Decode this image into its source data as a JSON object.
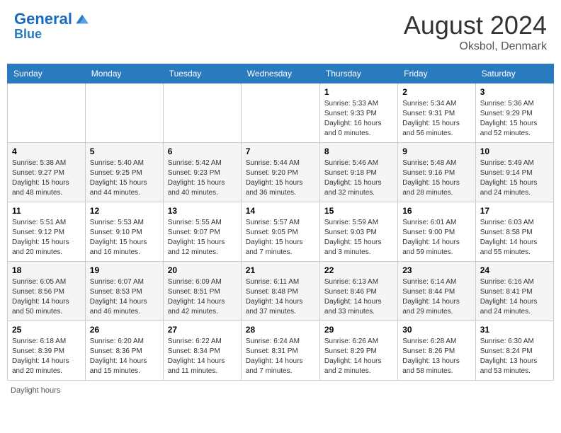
{
  "header": {
    "logo_line1": "General",
    "logo_line2": "Blue",
    "month_year": "August 2024",
    "location": "Oksbol, Denmark"
  },
  "days_of_week": [
    "Sunday",
    "Monday",
    "Tuesday",
    "Wednesday",
    "Thursday",
    "Friday",
    "Saturday"
  ],
  "footer": {
    "daylight_label": "Daylight hours"
  },
  "weeks": [
    {
      "days": [
        {
          "num": "",
          "info": ""
        },
        {
          "num": "",
          "info": ""
        },
        {
          "num": "",
          "info": ""
        },
        {
          "num": "",
          "info": ""
        },
        {
          "num": "1",
          "info": "Sunrise: 5:33 AM\nSunset: 9:33 PM\nDaylight: 16 hours\nand 0 minutes."
        },
        {
          "num": "2",
          "info": "Sunrise: 5:34 AM\nSunset: 9:31 PM\nDaylight: 15 hours\nand 56 minutes."
        },
        {
          "num": "3",
          "info": "Sunrise: 5:36 AM\nSunset: 9:29 PM\nDaylight: 15 hours\nand 52 minutes."
        }
      ]
    },
    {
      "days": [
        {
          "num": "4",
          "info": "Sunrise: 5:38 AM\nSunset: 9:27 PM\nDaylight: 15 hours\nand 48 minutes."
        },
        {
          "num": "5",
          "info": "Sunrise: 5:40 AM\nSunset: 9:25 PM\nDaylight: 15 hours\nand 44 minutes."
        },
        {
          "num": "6",
          "info": "Sunrise: 5:42 AM\nSunset: 9:23 PM\nDaylight: 15 hours\nand 40 minutes."
        },
        {
          "num": "7",
          "info": "Sunrise: 5:44 AM\nSunset: 9:20 PM\nDaylight: 15 hours\nand 36 minutes."
        },
        {
          "num": "8",
          "info": "Sunrise: 5:46 AM\nSunset: 9:18 PM\nDaylight: 15 hours\nand 32 minutes."
        },
        {
          "num": "9",
          "info": "Sunrise: 5:48 AM\nSunset: 9:16 PM\nDaylight: 15 hours\nand 28 minutes."
        },
        {
          "num": "10",
          "info": "Sunrise: 5:49 AM\nSunset: 9:14 PM\nDaylight: 15 hours\nand 24 minutes."
        }
      ]
    },
    {
      "days": [
        {
          "num": "11",
          "info": "Sunrise: 5:51 AM\nSunset: 9:12 PM\nDaylight: 15 hours\nand 20 minutes."
        },
        {
          "num": "12",
          "info": "Sunrise: 5:53 AM\nSunset: 9:10 PM\nDaylight: 15 hours\nand 16 minutes."
        },
        {
          "num": "13",
          "info": "Sunrise: 5:55 AM\nSunset: 9:07 PM\nDaylight: 15 hours\nand 12 minutes."
        },
        {
          "num": "14",
          "info": "Sunrise: 5:57 AM\nSunset: 9:05 PM\nDaylight: 15 hours\nand 7 minutes."
        },
        {
          "num": "15",
          "info": "Sunrise: 5:59 AM\nSunset: 9:03 PM\nDaylight: 15 hours\nand 3 minutes."
        },
        {
          "num": "16",
          "info": "Sunrise: 6:01 AM\nSunset: 9:00 PM\nDaylight: 14 hours\nand 59 minutes."
        },
        {
          "num": "17",
          "info": "Sunrise: 6:03 AM\nSunset: 8:58 PM\nDaylight: 14 hours\nand 55 minutes."
        }
      ]
    },
    {
      "days": [
        {
          "num": "18",
          "info": "Sunrise: 6:05 AM\nSunset: 8:56 PM\nDaylight: 14 hours\nand 50 minutes."
        },
        {
          "num": "19",
          "info": "Sunrise: 6:07 AM\nSunset: 8:53 PM\nDaylight: 14 hours\nand 46 minutes."
        },
        {
          "num": "20",
          "info": "Sunrise: 6:09 AM\nSunset: 8:51 PM\nDaylight: 14 hours\nand 42 minutes."
        },
        {
          "num": "21",
          "info": "Sunrise: 6:11 AM\nSunset: 8:48 PM\nDaylight: 14 hours\nand 37 minutes."
        },
        {
          "num": "22",
          "info": "Sunrise: 6:13 AM\nSunset: 8:46 PM\nDaylight: 14 hours\nand 33 minutes."
        },
        {
          "num": "23",
          "info": "Sunrise: 6:14 AM\nSunset: 8:44 PM\nDaylight: 14 hours\nand 29 minutes."
        },
        {
          "num": "24",
          "info": "Sunrise: 6:16 AM\nSunset: 8:41 PM\nDaylight: 14 hours\nand 24 minutes."
        }
      ]
    },
    {
      "days": [
        {
          "num": "25",
          "info": "Sunrise: 6:18 AM\nSunset: 8:39 PM\nDaylight: 14 hours\nand 20 minutes."
        },
        {
          "num": "26",
          "info": "Sunrise: 6:20 AM\nSunset: 8:36 PM\nDaylight: 14 hours\nand 15 minutes."
        },
        {
          "num": "27",
          "info": "Sunrise: 6:22 AM\nSunset: 8:34 PM\nDaylight: 14 hours\nand 11 minutes."
        },
        {
          "num": "28",
          "info": "Sunrise: 6:24 AM\nSunset: 8:31 PM\nDaylight: 14 hours\nand 7 minutes."
        },
        {
          "num": "29",
          "info": "Sunrise: 6:26 AM\nSunset: 8:29 PM\nDaylight: 14 hours\nand 2 minutes."
        },
        {
          "num": "30",
          "info": "Sunrise: 6:28 AM\nSunset: 8:26 PM\nDaylight: 13 hours\nand 58 minutes."
        },
        {
          "num": "31",
          "info": "Sunrise: 6:30 AM\nSunset: 8:24 PM\nDaylight: 13 hours\nand 53 minutes."
        }
      ]
    }
  ]
}
